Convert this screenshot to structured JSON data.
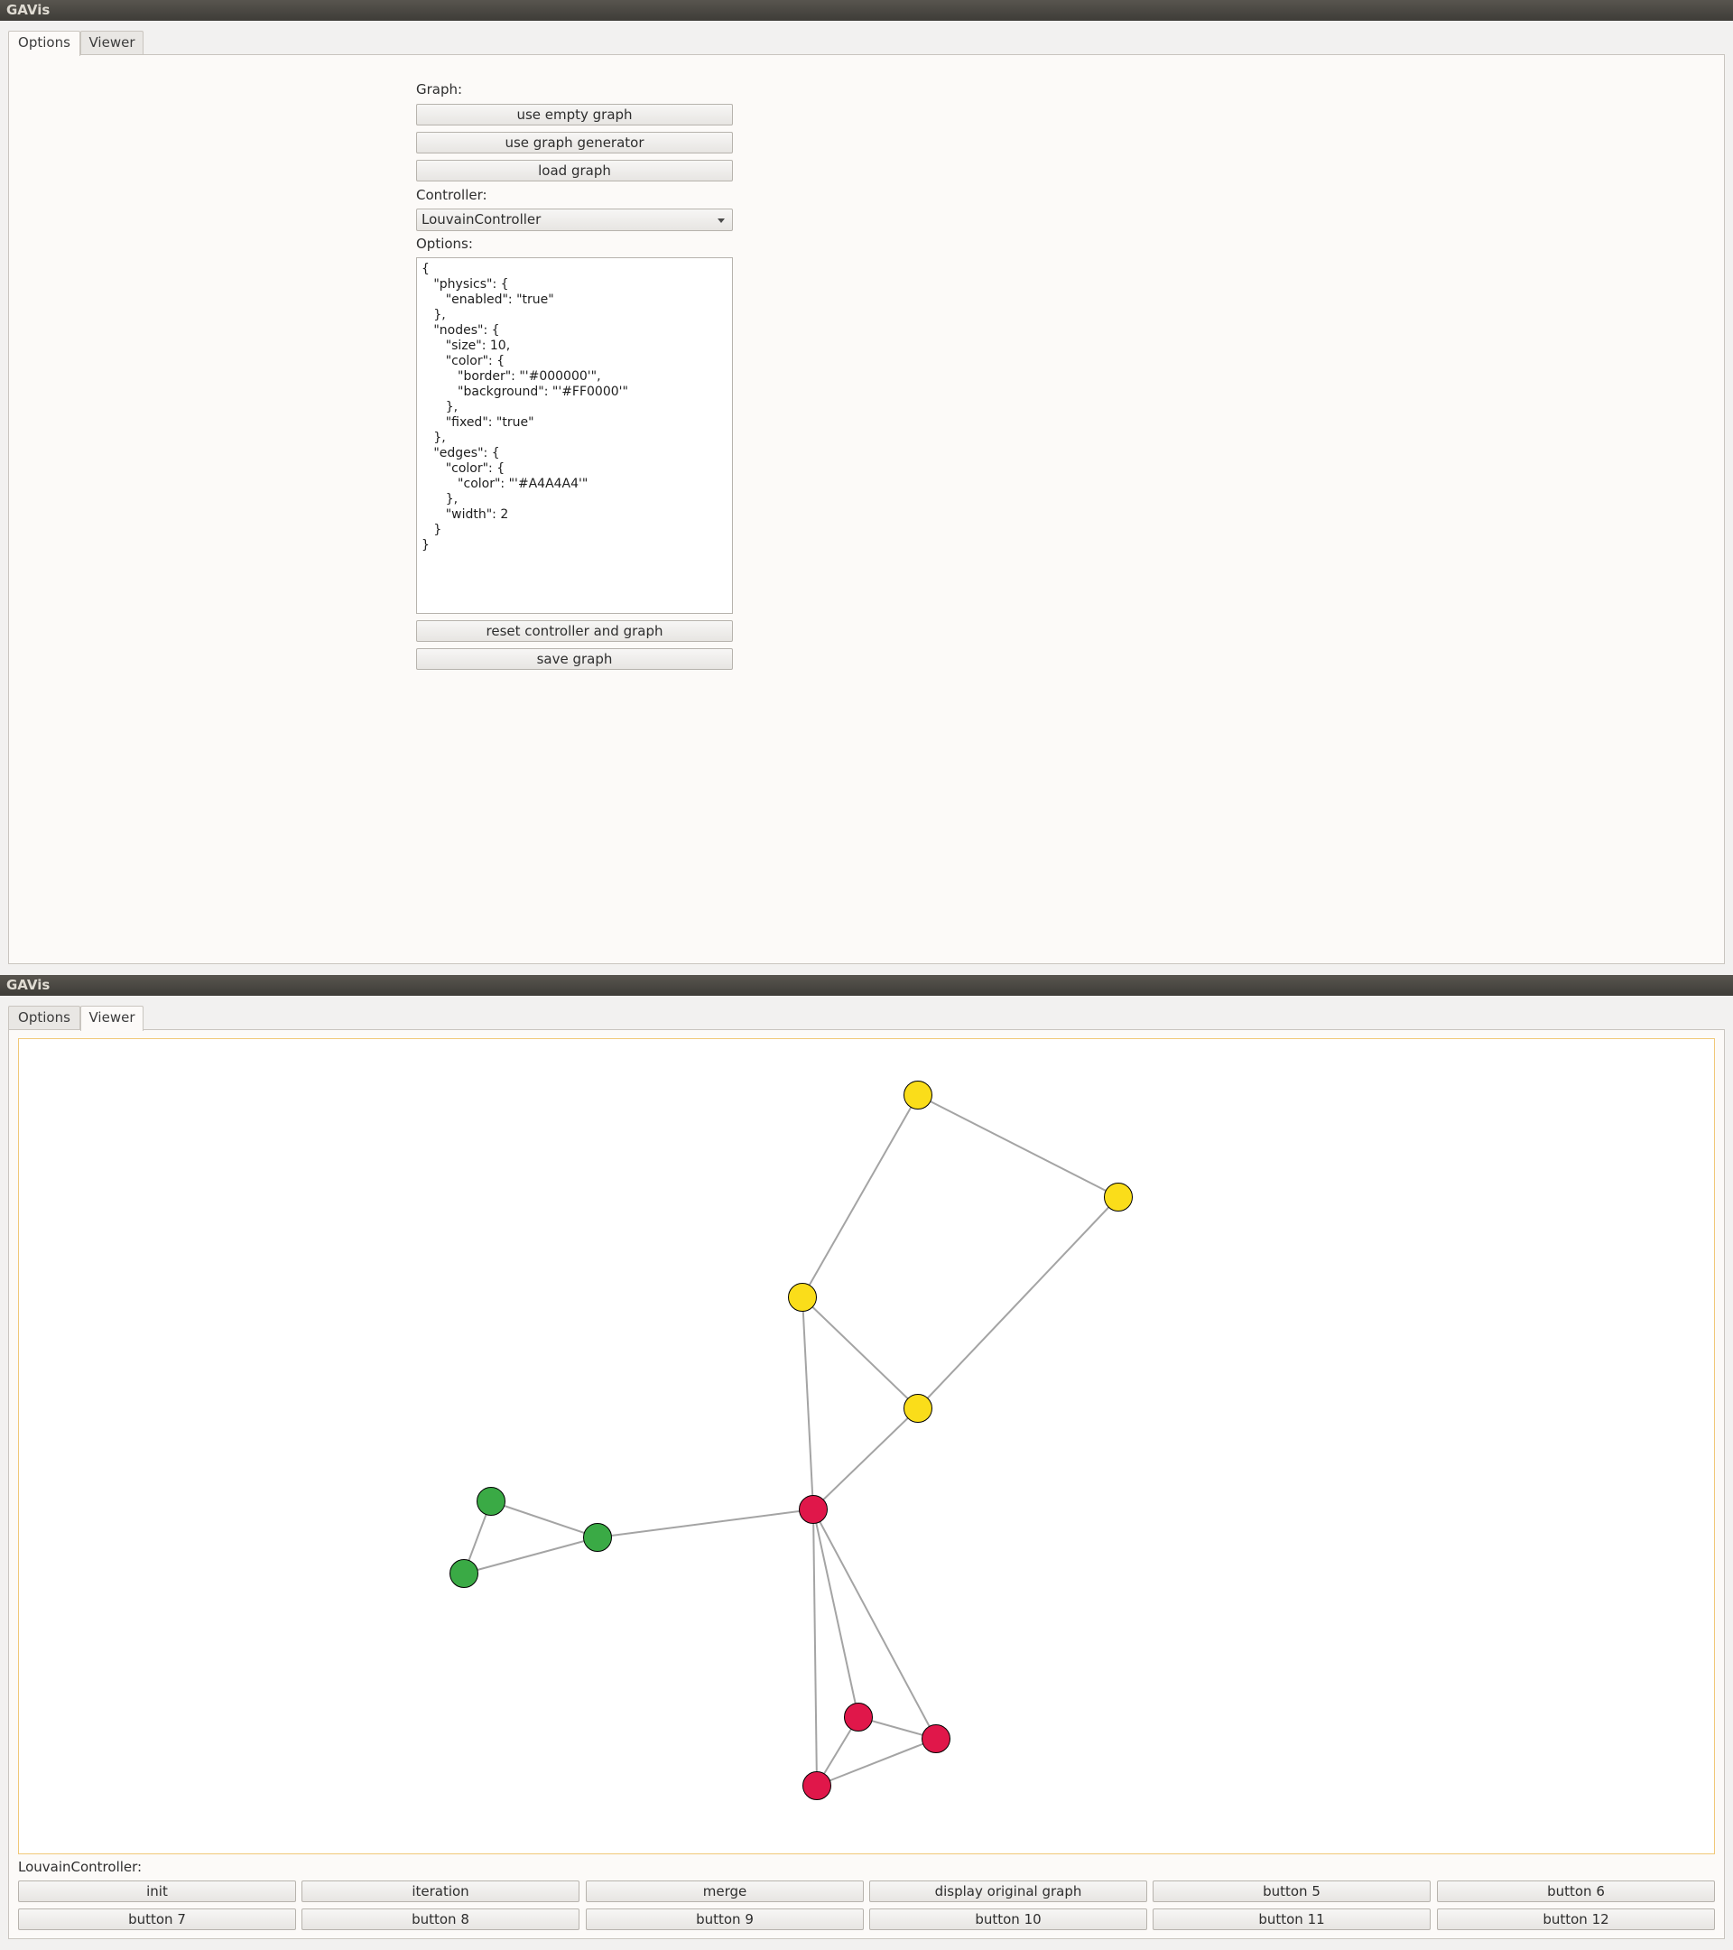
{
  "app_title": "GAVis",
  "tabs": {
    "options": "Options",
    "viewer": "Viewer"
  },
  "options_tab": {
    "graph_label": "Graph:",
    "use_empty_graph": "use empty graph",
    "use_graph_generator": "use graph generator",
    "load_graph": "load graph",
    "controller_label": "Controller:",
    "controller_value": "LouvainController",
    "options_label": "Options:",
    "options_text": "{\n   \"physics\": {\n      \"enabled\": \"true\"\n   },\n   \"nodes\": {\n      \"size\": 10,\n      \"color\": {\n         \"border\": \"'#000000'\",\n         \"background\": \"'#FF0000'\"\n      },\n      \"fixed\": \"true\"\n   },\n   \"edges\": {\n      \"color\": {\n         \"color\": \"'#A4A4A4'\"\n      },\n      \"width\": 2\n   }\n}",
    "reset_controller_and_graph": "reset controller and graph",
    "save_graph": "save graph"
  },
  "viewer_tab": {
    "controller_label": "LouvainController:",
    "buttons": [
      "init",
      "iteration",
      "merge",
      "display original graph",
      "button 5",
      "button 6",
      "button 7",
      "button 8",
      "button 9",
      "button 10",
      "button 11",
      "button 12"
    ]
  },
  "colors": {
    "yellow_community": "#fadd1a",
    "green_community": "#3aaa45",
    "red_community": "#e0174a",
    "edge": "#a4a4a4",
    "node_border": "#000000"
  }
}
